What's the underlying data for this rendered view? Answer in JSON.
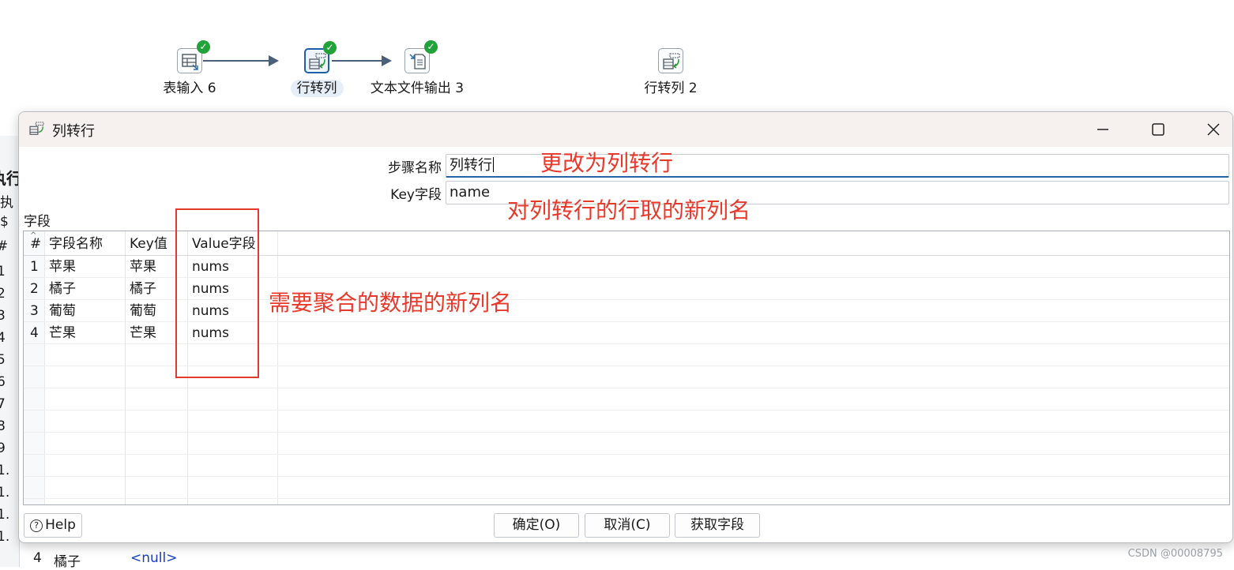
{
  "canvas": {
    "nodes": [
      {
        "label": "表输入 6",
        "icon": "table-input-icon",
        "status": "ok"
      },
      {
        "label": "行转列",
        "icon": "row-normaliser-icon",
        "status": "ok",
        "selected": true
      },
      {
        "label": "文本文件输出 3",
        "icon": "text-file-output-icon",
        "status": "ok"
      },
      {
        "label": "行转列 2",
        "icon": "row-normaliser-icon"
      }
    ],
    "left_strip": {
      "title": "执行",
      "radio1": "执",
      "radio2": "$",
      "rows": [
        "#",
        "1",
        "2",
        "3",
        "4",
        "5",
        "6",
        "7",
        "8",
        "9",
        "1.",
        "1.",
        "1.",
        "1."
      ]
    },
    "bottom_row": {
      "num": "4",
      "name": "橘子",
      "value": "<null>"
    }
  },
  "dialog": {
    "title": "列转行",
    "step_name_label": "步骤名称",
    "step_name_value": "列转行",
    "key_field_label": "Key字段",
    "key_field_value": "name",
    "fields_section": "字段",
    "columns": [
      "#",
      "字段名称",
      "Key值",
      "Value字段"
    ],
    "rows": [
      [
        "1",
        "苹果",
        "苹果",
        "nums"
      ],
      [
        "2",
        "橘子",
        "橘子",
        "nums"
      ],
      [
        "3",
        "葡萄",
        "葡萄",
        "nums"
      ],
      [
        "4",
        "芒果",
        "芒果",
        "nums"
      ]
    ],
    "buttons": {
      "help": "Help",
      "ok": "确定(O)",
      "cancel": "取消(C)",
      "get_fields": "获取字段"
    }
  },
  "annotations": {
    "step_name": "更改为列转行",
    "key_field": "对列转行的行取的新列名",
    "value_field": "需要聚合的数据的新列名",
    "color": "#e8392a"
  },
  "watermark": "CSDN @00008795"
}
